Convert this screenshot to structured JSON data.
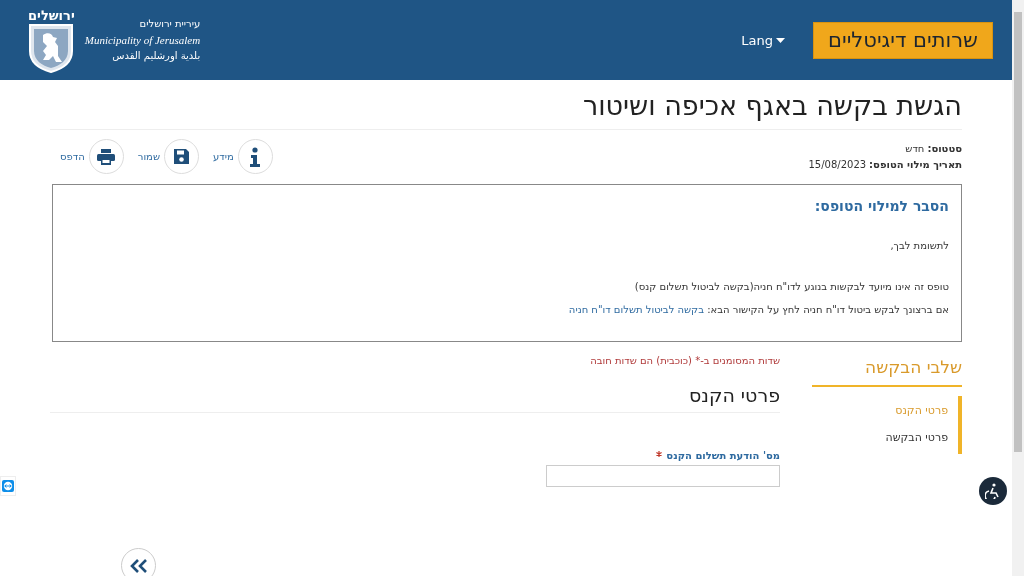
{
  "header": {
    "logo": {
      "crest_title": "ירושלים",
      "hebrew": "עיריית ירושלים",
      "english": "Municipality of Jerusalem",
      "arabic": "بلدية اورشليم القدس"
    },
    "lang": "Lang",
    "digital_button": "שרותים דיגיטליים"
  },
  "page": {
    "title": "הגשת בקשה באגף אכיפה ושיטור",
    "meta": [
      {
        "label": "סטטוס:",
        "value": "חדש"
      },
      {
        "label": "תאריך מילוי הטופס:",
        "value": "15/08/2023"
      }
    ],
    "actions": [
      {
        "kind": "info",
        "label": "מידע"
      },
      {
        "kind": "save",
        "label": "שמור"
      },
      {
        "kind": "print",
        "label": "הדפס"
      }
    ]
  },
  "notice": {
    "heading": "הסבר למילוי הטופס:",
    "greeting": "לתשומת לבך,",
    "line": "טופס זה אינו מיועד לבקשות בנוגע לדו\"ח חניה(בקשה לביטול תשלום קנס)",
    "link_sentence": "אם ברצונך לבקש ביטול דו\"ח חניה לחץ על הקישור הבא:",
    "link": "בקשה לביטול תשלום דו\"ח חניה"
  },
  "steps": {
    "title": "שלבי הבקשה",
    "items": [
      {
        "label": "פרטי הקנס",
        "selected": true
      },
      {
        "label": "פרטי הבקשה",
        "selected": false
      }
    ]
  },
  "form": {
    "required_note": "שדות המסומנים ב-* (כוכבית) הם שדות חובה",
    "section_title": "פרטי הקנס",
    "fields": [
      {
        "label": "מס' הודעת תשלום הקנס",
        "required": true
      }
    ]
  }
}
